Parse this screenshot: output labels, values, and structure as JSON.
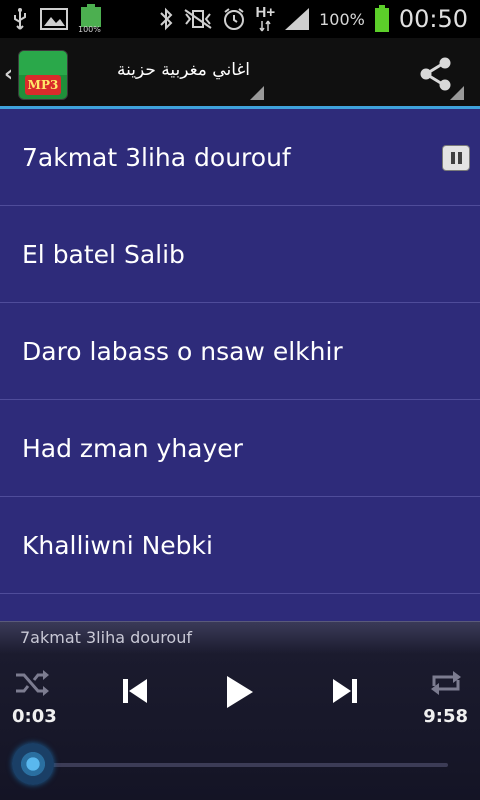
{
  "status_bar": {
    "battery_small_percent": "100%",
    "h_plus": "H+",
    "battery_percent": "100%",
    "clock": "00:50"
  },
  "action_bar": {
    "title": "اغاني مغربية حزينة",
    "logo_text": "MP3",
    "accent_color": "#3fa2dc"
  },
  "songs": [
    {
      "title": "7akmat 3liha dourouf",
      "playing": true
    },
    {
      "title": "El batel Salib",
      "playing": false
    },
    {
      "title": "Daro labass o nsaw elkhir",
      "playing": false
    },
    {
      "title": "Had zman yhayer",
      "playing": false
    },
    {
      "title": "Khalliwni Nebki",
      "playing": false
    }
  ],
  "player": {
    "now_playing": "7akmat 3liha dourouf",
    "current_time": "0:03",
    "total_time": "9:58",
    "progress_fraction": 0.005,
    "controls": [
      "shuffle-icon",
      "previous-icon",
      "play-icon",
      "next-icon",
      "repeat-icon"
    ]
  },
  "colors": {
    "list_background": "#2e2b7a",
    "divider": "#4f4c9a",
    "player_background": "#141425"
  }
}
